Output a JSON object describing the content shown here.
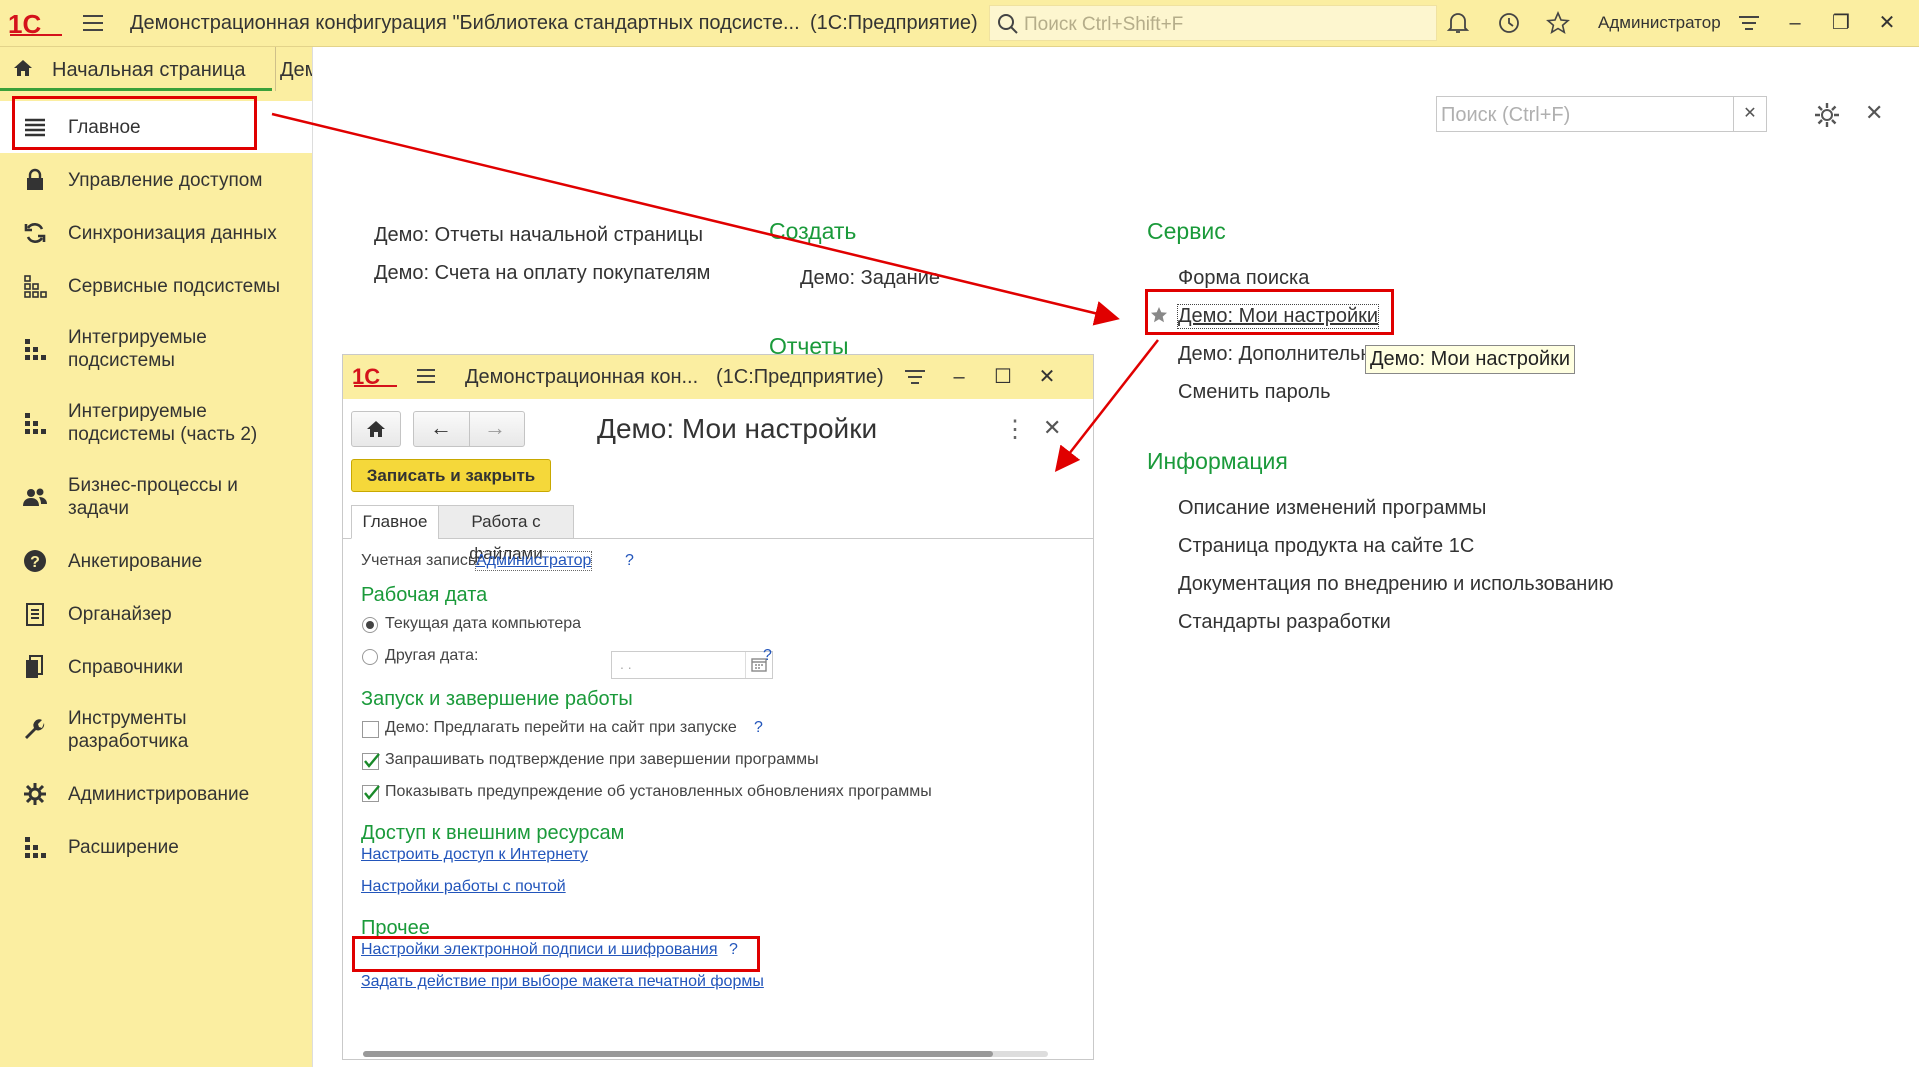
{
  "app": {
    "title": "Демонстрационная конфигурация \"Библиотека стандартных подсисте...",
    "title_suffix": "(1С:Предприятие)",
    "search_placeholder": "Поиск Ctrl+Shift+F",
    "user": "Администратор"
  },
  "tabs": [
    {
      "label": "Начальная страница"
    },
    {
      "label": "Дем"
    }
  ],
  "sidebar": {
    "items": [
      {
        "label": "Главное",
        "icon": "menu-icon"
      },
      {
        "label": "Управление доступом",
        "icon": "lock-icon"
      },
      {
        "label": "Синхронизация данных",
        "icon": "sync-icon"
      },
      {
        "label": "Сервисные подсистемы",
        "icon": "grid-icon"
      },
      {
        "label": "Интегрируемые подсистемы",
        "icon": "blocks-icon"
      },
      {
        "label": "Интегрируемые подсистемы (часть 2)",
        "icon": "blocks-icon"
      },
      {
        "label": "Бизнес-процессы и задачи",
        "icon": "users-icon"
      },
      {
        "label": "Анкетирование",
        "icon": "question-icon"
      },
      {
        "label": "Органайзер",
        "icon": "notebook-icon"
      },
      {
        "label": "Справочники",
        "icon": "books-icon"
      },
      {
        "label": "Инструменты разработчика",
        "icon": "wrench-icon"
      },
      {
        "label": "Администрирование",
        "icon": "gear-icon"
      },
      {
        "label": "Расширение",
        "icon": "blocks-icon"
      }
    ]
  },
  "main": {
    "search_placeholder": "Поиск (Ctrl+F)",
    "left_links": [
      "Демо: Отчеты начальной страницы",
      "Демо: Счета на оплату покупателям"
    ],
    "create_heading": "Создать",
    "create_links": [
      "Демо: Задание"
    ],
    "reports_heading": "Отчеты",
    "service_heading": "Сервис",
    "service_links": [
      "Форма поиска",
      "Демо: Мои настройки",
      "Демо: Дополнительн",
      "Сменить пароль"
    ],
    "info_heading": "Информация",
    "info_links": [
      "Описание изменений программы",
      "Страница продукта на сайте 1С",
      "Документация по внедрению и использованию",
      "Стандарты разработки"
    ],
    "tooltip": "Демо: Мои настройки"
  },
  "modal": {
    "window_title": "Демонстрационная кон...",
    "window_title_suffix": "(1С:Предприятие)",
    "header": "Демо: Мои настройки",
    "save_button": "Записать и закрыть",
    "tabs": [
      "Главное",
      "Работа с файлами"
    ],
    "account_label": "Учетная запись:",
    "account_value": "Администратор",
    "work_date_heading": "Рабочая дата",
    "radio_current": "Текущая дата компьютера",
    "radio_other": "Другая дата:",
    "date_value": ".  .",
    "startup_heading": "Запуск и завершение работы",
    "checks": [
      {
        "label": "Демо: Предлагать перейти на сайт при запуске",
        "checked": false
      },
      {
        "label": "Запрашивать подтверждение при завершении программы",
        "checked": true
      },
      {
        "label": "Показывать предупреждение об установленных обновлениях программы",
        "checked": true
      }
    ],
    "external_heading": "Доступ к внешним ресурсам",
    "external_links": [
      "Настроить доступ к Интернету",
      "Настройки работы с почтой"
    ],
    "other_heading": "Прочее",
    "other_links": [
      "Настройки электронной подписи и шифрования",
      "Задать действие при выборе макета печатной формы"
    ],
    "help_mark": "?"
  },
  "colors": {
    "accent_yellow": "#fbeea1",
    "heading_green": "#1a9a3a",
    "highlight_red": "#e00000",
    "button_yellow": "#f5d83a"
  }
}
